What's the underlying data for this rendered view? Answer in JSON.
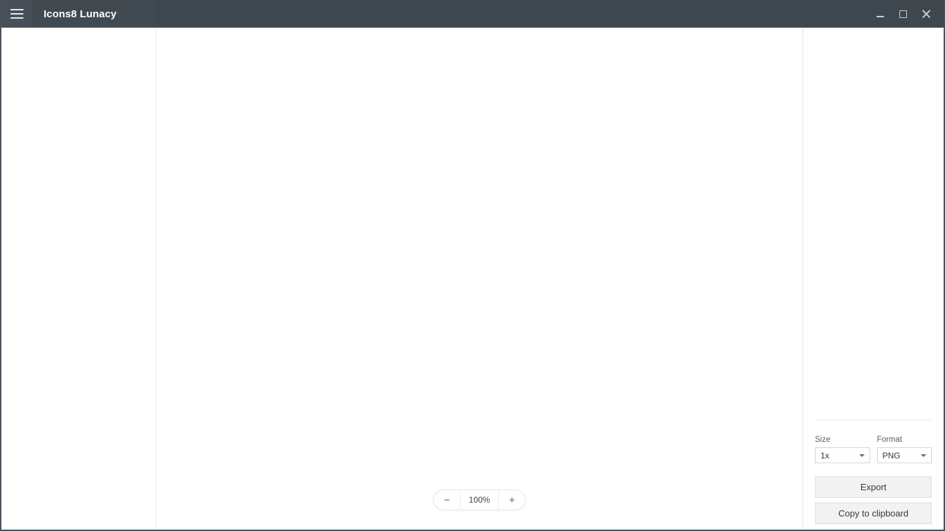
{
  "window": {
    "app_title": "Icons8 Lunacy",
    "menu_icon": "hamburger-menu-icon",
    "controls": {
      "minimize_icon": "minimize-icon",
      "maximize_icon": "maximize-icon",
      "close_icon": "close-icon"
    }
  },
  "canvas": {
    "zoom": {
      "decrease_label": "−",
      "value": "100%",
      "increase_label": "+",
      "decrease_icon": "minus-icon",
      "increase_icon": "plus-icon"
    }
  },
  "export_panel": {
    "size": {
      "label": "Size",
      "value": "1x",
      "arrow_icon": "chevron-down-icon"
    },
    "format": {
      "label": "Format",
      "value": "PNG",
      "arrow_icon": "chevron-down-icon"
    },
    "export_label": "Export",
    "copy_label": "Copy to clipboard"
  },
  "colors": {
    "titlebar": "#3e464e",
    "titlebar_menu": "#474f58",
    "titlebar_title_block": "#414951",
    "panel_button": "#f2f2f2",
    "border": "#e4e7ea"
  }
}
